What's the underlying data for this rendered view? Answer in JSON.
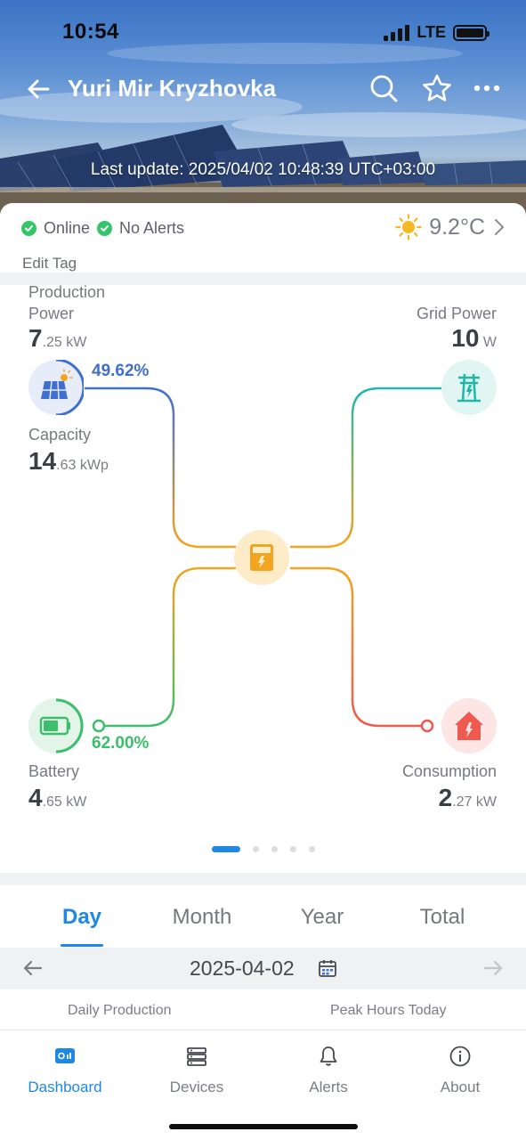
{
  "status_bar": {
    "time": "10:54",
    "network": "LTE"
  },
  "header": {
    "title": "Yuri Mir Kryzhovka",
    "last_update": "Last update: 2025/04/02 10:48:39 UTC+03:00",
    "icons": [
      "back-arrow-icon",
      "search-icon",
      "star-icon",
      "more-icon"
    ]
  },
  "status": {
    "online": "Online",
    "alerts": "No Alerts",
    "temperature": "9.2°C",
    "weather_icon": "sun-icon",
    "edit_tag": "Edit Tag"
  },
  "energy_flow": {
    "production": {
      "label_line1": "Production",
      "label_line2": "Power",
      "value_int": "7",
      "value_dec": ".25",
      "unit": "kW",
      "percent": "49.62%"
    },
    "capacity": {
      "label": "Capacity",
      "value_int": "14",
      "value_dec": ".63",
      "unit": "kWp"
    },
    "grid": {
      "label": "Grid Power",
      "value_int": "10",
      "unit": "W"
    },
    "battery": {
      "label": "Battery",
      "value_int": "4",
      "value_dec": ".65",
      "unit": "kW",
      "percent": "62.00%"
    },
    "consumption": {
      "label": "Consumption",
      "value_int": "2",
      "value_dec": ".27",
      "unit": "kW"
    },
    "colors": {
      "solar": "#3f6fd1",
      "grid": "#1fb8a6",
      "battery": "#3cbf6a",
      "consumption": "#ee5a4f",
      "inverter": "#f3a521"
    },
    "pager": {
      "total": 5,
      "active": 0
    }
  },
  "period_tabs": {
    "day": "Day",
    "month": "Month",
    "year": "Year",
    "total": "Total",
    "active": "Day"
  },
  "date_nav": {
    "date": "2025-04-02"
  },
  "summary": {
    "left": "Daily Production",
    "right": "Peak Hours Today"
  },
  "bottom_nav": {
    "items": [
      {
        "label": "Dashboard",
        "icon": "dashboard-icon",
        "active": true
      },
      {
        "label": "Devices",
        "icon": "devices-icon",
        "active": false
      },
      {
        "label": "Alerts",
        "icon": "bell-icon",
        "active": false
      },
      {
        "label": "About",
        "icon": "info-icon",
        "active": false
      }
    ]
  },
  "accent_color": "#1e88e5"
}
